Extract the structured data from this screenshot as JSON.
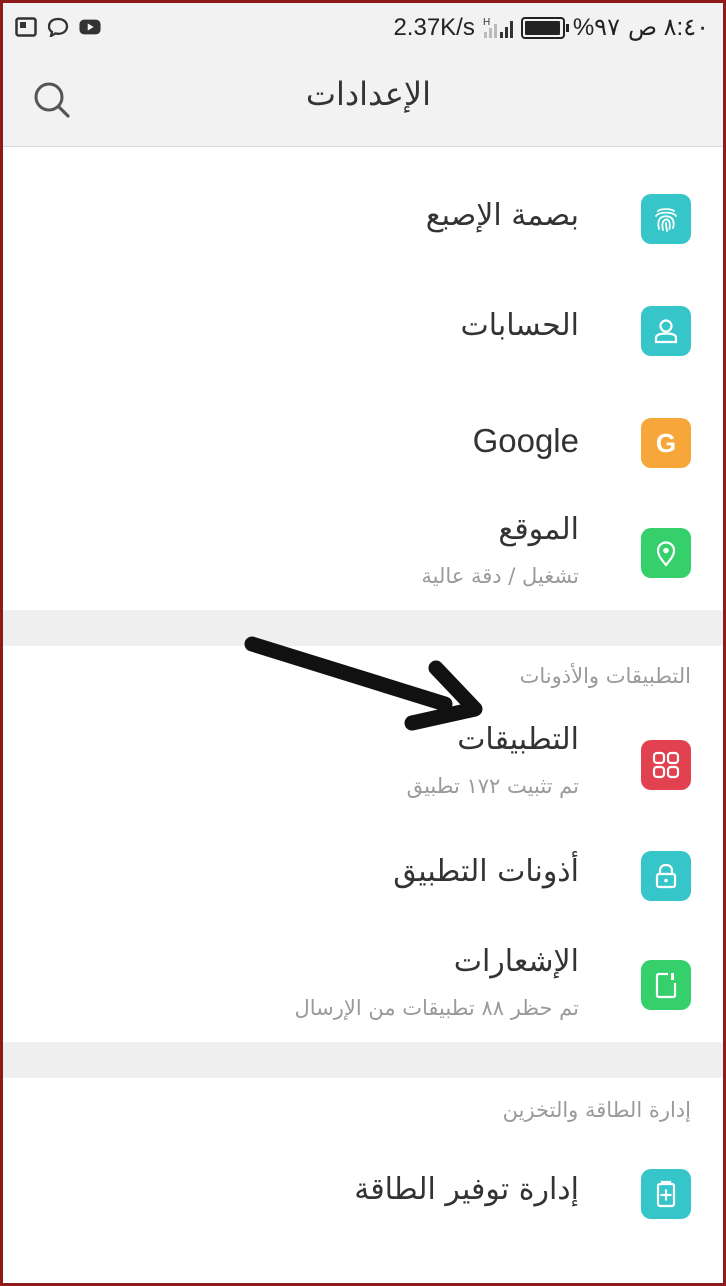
{
  "status_bar": {
    "left_icons": [
      "screenshot-icon",
      "chat-bubble-icon",
      "youtube-icon"
    ],
    "speed": "2.37K/s",
    "battery_percent_text": "%۹۷",
    "battery_level": 0.97,
    "time": "٨:٤٠ ص"
  },
  "app_bar": {
    "title": "الإعدادات",
    "search_icon": "search-icon"
  },
  "items": {
    "fingerprint": {
      "title": "بصمة الإصبع",
      "icon": "fingerprint-icon",
      "color": "#36c6c9"
    },
    "accounts": {
      "title": "الحسابات",
      "icon": "person-icon",
      "color": "#36c6c9"
    },
    "google": {
      "title": "Google",
      "icon": "google-icon",
      "icon_letter": "G",
      "color": "#f7a73a"
    },
    "location": {
      "title": "الموقع",
      "subtitle": "تشغيل / دقة عالية",
      "icon": "location-pin-icon",
      "color": "#35cf6b"
    }
  },
  "section_apps": {
    "header": "التطبيقات والأذونات",
    "apps": {
      "title": "التطبيقات",
      "subtitle": "تم تثبيت ١٧٢ تطبيق",
      "icon": "apps-grid-icon",
      "color": "#e2424f"
    },
    "permissions": {
      "title": "أذونات التطبيق",
      "icon": "lock-icon",
      "color": "#36c6c9"
    },
    "notifications": {
      "title": "الإشعارات",
      "subtitle": "تم حظر ٨٨ تطبيقات من الإرسال",
      "icon": "notification-icon",
      "color": "#35cf6b"
    }
  },
  "section_power": {
    "header": "إدارة الطاقة والتخزين",
    "battery_saver": {
      "title": "إدارة توفير الطاقة",
      "icon": "battery-plus-icon",
      "color": "#36c6c9"
    }
  }
}
